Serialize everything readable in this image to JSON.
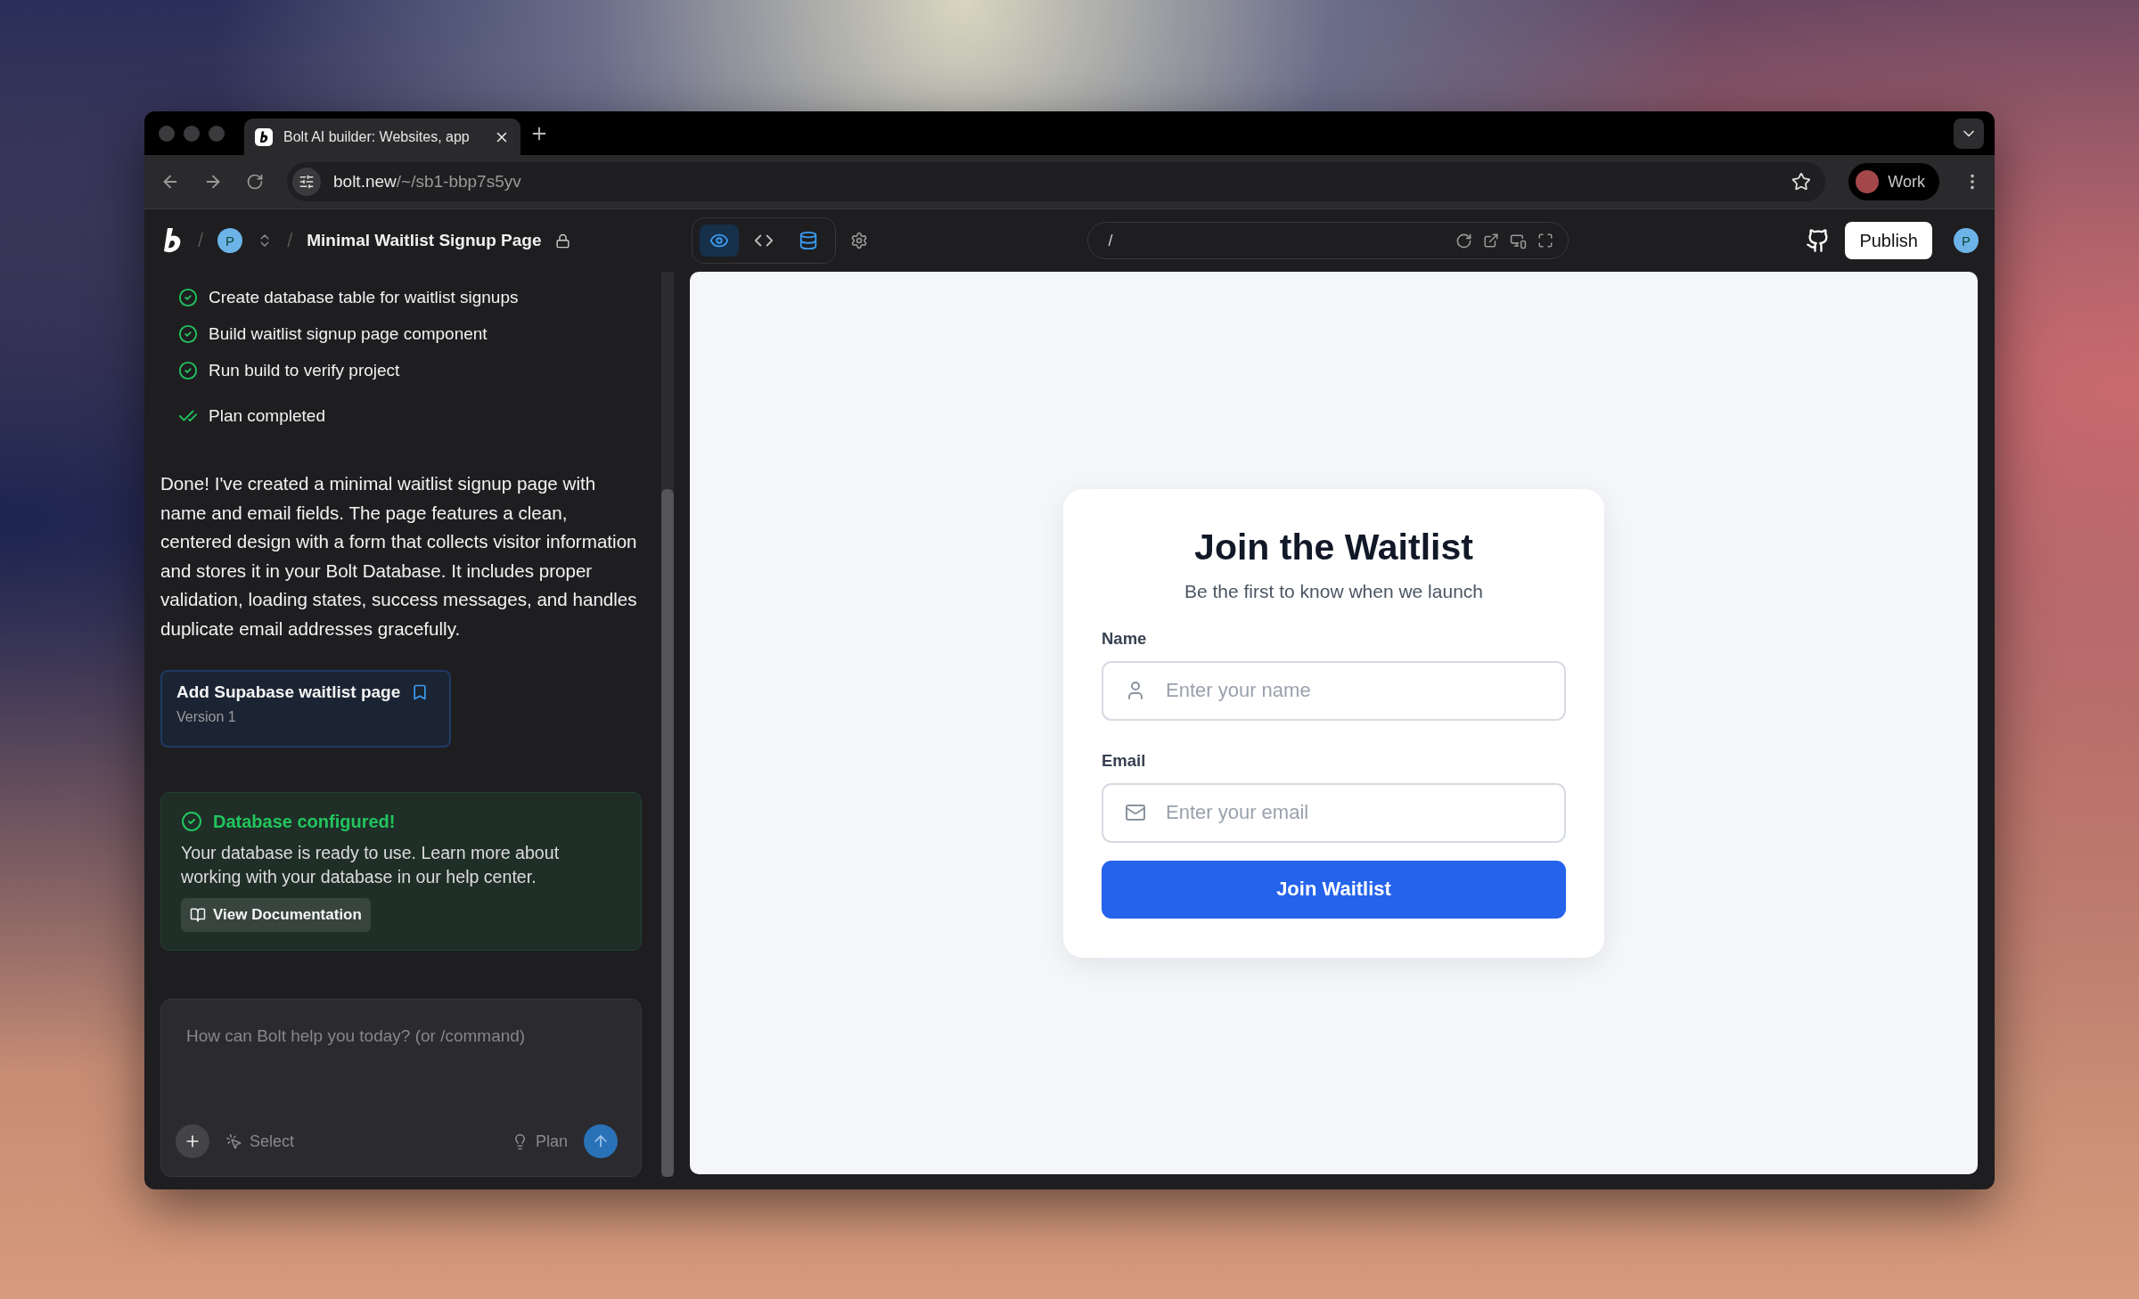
{
  "browser": {
    "tab_title": "Bolt AI builder: Websites, app",
    "address": {
      "domain": "bolt.new",
      "path": "/~/sb1-bbp7s5yv"
    },
    "profile": "Work"
  },
  "app_header": {
    "separators": [
      "/",
      "/"
    ],
    "project_initial": "P",
    "project_title": "Minimal Waitlist Signup Page",
    "view_tabs": [
      {
        "kind": "preview",
        "selected": true
      },
      {
        "kind": "code",
        "selected": false
      },
      {
        "kind": "database",
        "selected": false
      }
    ],
    "preview_path": "/",
    "publish": "Publish",
    "user_initial": "P"
  },
  "chat": {
    "plan_steps": [
      {
        "text": "Create database table for waitlist signups",
        "done": true
      },
      {
        "text": "Build waitlist signup page component",
        "done": true
      },
      {
        "text": "Run build to verify project",
        "done": true
      }
    ],
    "plan_status": "Plan completed",
    "message": "Done! I've created a minimal waitlist signup page with name and email fields. The page features a clean, centered design with a form that collects visitor information and stores it in your Bolt Database. It includes proper validation, loading states, success messages, and handles duplicate email addresses gracefully.",
    "version_card": {
      "title": "Add Supabase waitlist page",
      "version": "Version 1"
    },
    "db_notice": {
      "title": "Database configured!",
      "body": "Your database is ready to use. Learn more about working with your database in our help center.",
      "button": "View Documentation"
    },
    "composer": {
      "placeholder": "How can Bolt help you today? (or /command)",
      "select": "Select",
      "plan": "Plan"
    }
  },
  "preview": {
    "title": "Join the Waitlist",
    "subtitle": "Be the first to know when we launch",
    "fields": [
      {
        "kind": "name",
        "label": "Name",
        "placeholder": "Enter your name"
      },
      {
        "kind": "email",
        "label": "Email",
        "placeholder": "Enter your email"
      }
    ],
    "submit": "Join Waitlist"
  }
}
